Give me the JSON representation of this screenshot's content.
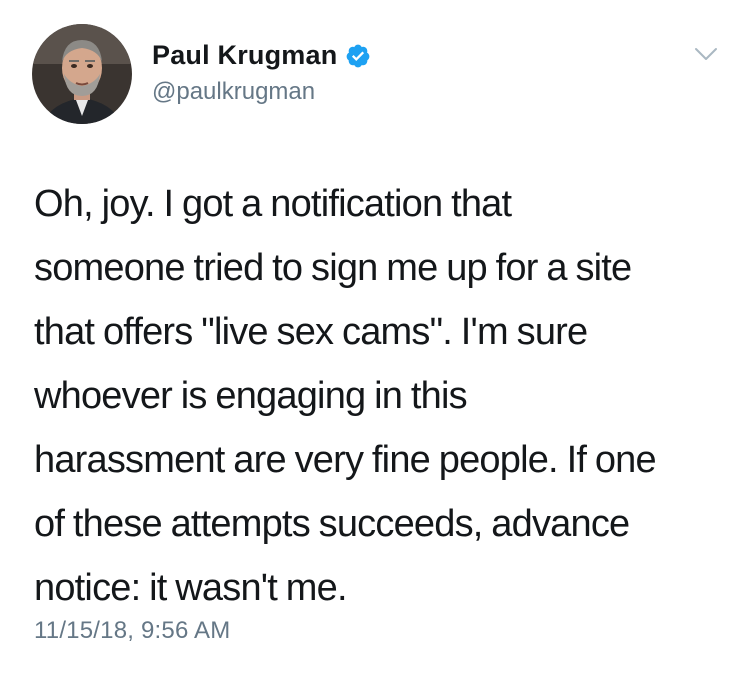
{
  "author": {
    "display_name": "Paul Krugman",
    "handle": "@paulkrugman",
    "verified": true
  },
  "tweet": {
    "lines": [
      "Oh, joy. I got a notification that",
      "someone tried to sign me up for a site",
      "that offers \"live sex cams\". I'm sure",
      "whoever is engaging in this",
      "harassment are very fine people. If one",
      "of these attempts succeeds, advance",
      "notice: it wasn't me."
    ],
    "timestamp": "11/15/18, 9:56 AM"
  },
  "icons": {
    "verified": "verified-badge-icon",
    "menu": "chevron-down-icon"
  },
  "colors": {
    "text": "#14171a",
    "secondary": "#657786",
    "verified_blue": "#1da1f2"
  }
}
